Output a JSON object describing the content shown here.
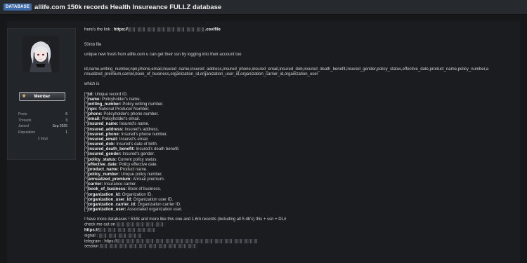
{
  "header": {
    "badge": "DATABASE",
    "title": "allife.com 150k records Health Insureance FULLZ database"
  },
  "user": {
    "rank": "Member",
    "stats": [
      {
        "label": "Posts",
        "value": "6"
      },
      {
        "label": "Threads",
        "value": "3"
      },
      {
        "label": "Joined",
        "value": "Sep 2025"
      },
      {
        "label": "Reputation",
        "value": "1"
      }
    ],
    "time_online": "3 days"
  },
  "post": {
    "link_prefix": "here's the link : ",
    "link_start": "https://",
    "link_end": ".csv/file",
    "size": "50mb file",
    "desc": "unique new fresh from allife.com  u can get their ssn by logging into their account too",
    "columns_line1": "id,name,writing_number,npn,phone,email,insured_name,insured_address,insured_phone,insured_email,insured_dob,insured_death_benefit,insured_gender,policy_status,effective_date,product_name,policy_number,a",
    "columns_line2": "nnualized_premium,carrier,book_of_business,organization_id,organization_user_id,organization_carrier_id,organization_user",
    "which_is": "which is",
    "fields": [
      {
        "key": "id",
        "desc": "Unique record ID."
      },
      {
        "key": "name",
        "desc": "Policyholder's name."
      },
      {
        "key": "writing_number",
        "desc": "Policy writing number."
      },
      {
        "key": "npn",
        "desc": "National Producer Number."
      },
      {
        "key": "phone",
        "desc": "Policyholder's phone number."
      },
      {
        "key": "email",
        "desc": "Policyholder's email."
      },
      {
        "key": "insured_name",
        "desc": "Insured's name."
      },
      {
        "key": "insured_address",
        "desc": "Insured's address."
      },
      {
        "key": "insured_phone",
        "desc": "Insured's phone number."
      },
      {
        "key": "insured_email",
        "desc": "Insured's email."
      },
      {
        "key": "insured_dob",
        "desc": "Insured's date of birth."
      },
      {
        "key": "insured_death_benefit",
        "desc": "Insured's death benefit."
      },
      {
        "key": "insured_gender",
        "desc": "Insured's gender."
      },
      {
        "key": "policy_status",
        "desc": "Current policy status."
      },
      {
        "key": "effective_date",
        "desc": "Policy effective date."
      },
      {
        "key": "product_name",
        "desc": "Product name."
      },
      {
        "key": "policy_number",
        "desc": "Unique policy number."
      },
      {
        "key": "annualized_premium",
        "desc": "Annual premium."
      },
      {
        "key": "carrier",
        "desc": "Insurance carrier."
      },
      {
        "key": "book_of_business",
        "desc": "Book of business."
      },
      {
        "key": "organization_id",
        "desc": "Organization ID."
      },
      {
        "key": "organization_user_id",
        "desc": "Organization user ID."
      },
      {
        "key": "organization_carrier_id",
        "desc": "Organization carrier ID."
      },
      {
        "key": "organization_user",
        "desc": "Associated organization user."
      }
    ],
    "field_prefix": "[*]",
    "more_db": "I have more databases ! 534k and more like this one and 1.6m records (including all 5 db's) this + ssn + DL#",
    "check_me": "check me out on",
    "https_label": "https://",
    "signal_label": "signal :",
    "telegram_label": "telegram : https://",
    "session_label": "session"
  }
}
